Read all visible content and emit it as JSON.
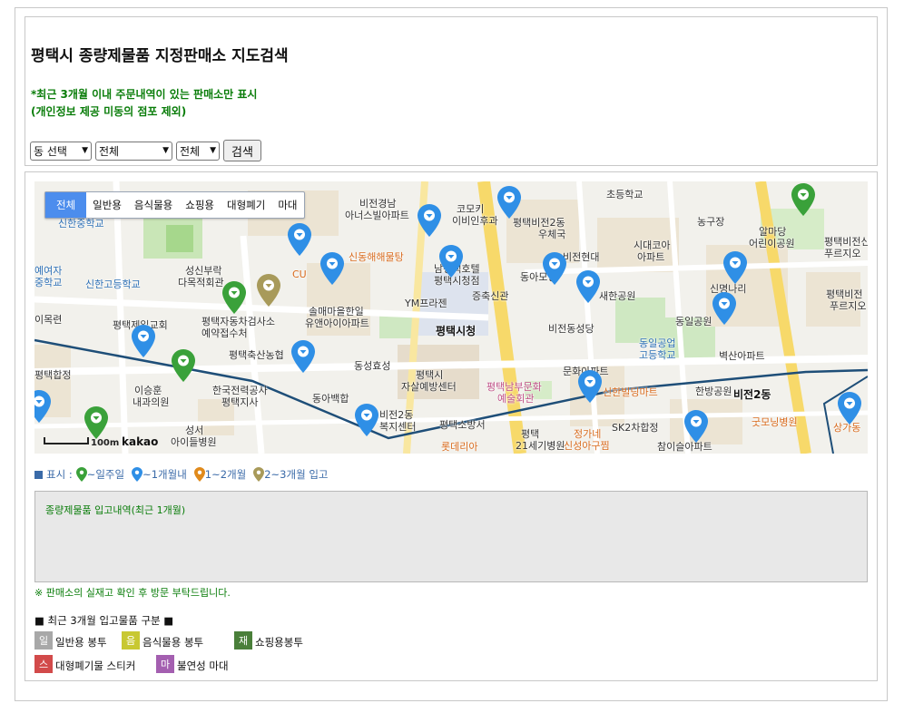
{
  "header": {
    "title": "평택시 종량제물품 지정판매소 지도검색",
    "notice_line1": "*최근 3개월 이내 주문내역이 있는 판매소만 표시",
    "notice_line2": "(개인정보 제공 미동의 점포 제외)"
  },
  "filters": {
    "dong": "동 선택",
    "type": "전체",
    "period": "전체",
    "search_label": "검색"
  },
  "map": {
    "tabs": [
      "전체",
      "일반용",
      "음식물용",
      "쇼핑용",
      "대형폐기",
      "마대"
    ],
    "active_tab": "전체",
    "scale_text": "100m",
    "provider": "kakao",
    "labels": [
      "비전경남",
      "아너스빌아파트",
      "코모키",
      "이비인후과",
      "평택비전2동",
      "우체국",
      "초등학교",
      "농구장",
      "알마당",
      "어린이공원",
      "평택비전신",
      "푸르지오",
      "신한중학교",
      "성신부락",
      "다목적회관",
      "신동해해물탕",
      "남평택호텔",
      "평택시청점",
      "시대코아",
      "아파트",
      "비전현대",
      "동아모닝",
      "신한고등학교",
      "CU",
      "솔매마을한일",
      "유앤아이아파트",
      "YM프라젠",
      "증축신관",
      "새한공원",
      "신명나리",
      "평택비전",
      "푸르지오",
      "평택제일교회",
      "비전동성당",
      "평택시청",
      "동일공원",
      "평택자동차검사소",
      "예약접수처",
      "동일공업",
      "고등학교",
      "벽산아파트",
      "평택축산농협",
      "동성효성",
      "평택시",
      "자살예방센터",
      "문화아파트",
      "한방공원",
      "비전2동",
      "평택남부문화",
      "예술회관",
      "신한빌딩마트",
      "이승훈",
      "내과의원",
      "한국전력공사",
      "평택지사",
      "동아백합",
      "비전2동",
      "복지센터",
      "SK2차합정",
      "굿모닝병원",
      "성서",
      "아이들병원",
      "평택소방서",
      "평택",
      "21세기병원",
      "정가네",
      "신성아구찜",
      "참이슬아파트",
      "상가동",
      "롯데리아",
      "이목련",
      "평택합정",
      "예여자",
      "중학교"
    ]
  },
  "legend": {
    "prefix": "표시 :",
    "items": [
      "~일주일",
      "~1개월내",
      "1~2개월",
      "2~3개월 입고"
    ],
    "colors": [
      "#3aa13a",
      "#2f8fe6",
      "#e08a1c",
      "#a89a5a"
    ]
  },
  "history": {
    "title": "종량제물품 입고내역(최근 1개월)"
  },
  "note": "※ 판매소의 실재고 확인 후 방문 부탁드립니다.",
  "categories": {
    "title": "■ 최근 3개월 입고물품 구분 ■",
    "items": [
      {
        "badge": "일",
        "label": "일반용 봉투",
        "color": "#a8a8a8"
      },
      {
        "badge": "음",
        "label": "음식물용 봉투",
        "color": "#c8c832"
      },
      {
        "badge": "재",
        "label": "쇼핑용봉투",
        "color": "#4a7f3a"
      },
      {
        "badge": "스",
        "label": "대형폐기물 스티커",
        "color": "#d24a4a"
      },
      {
        "badge": "마",
        "label": "불연성 마대",
        "color": "#a45fb0"
      }
    ]
  }
}
